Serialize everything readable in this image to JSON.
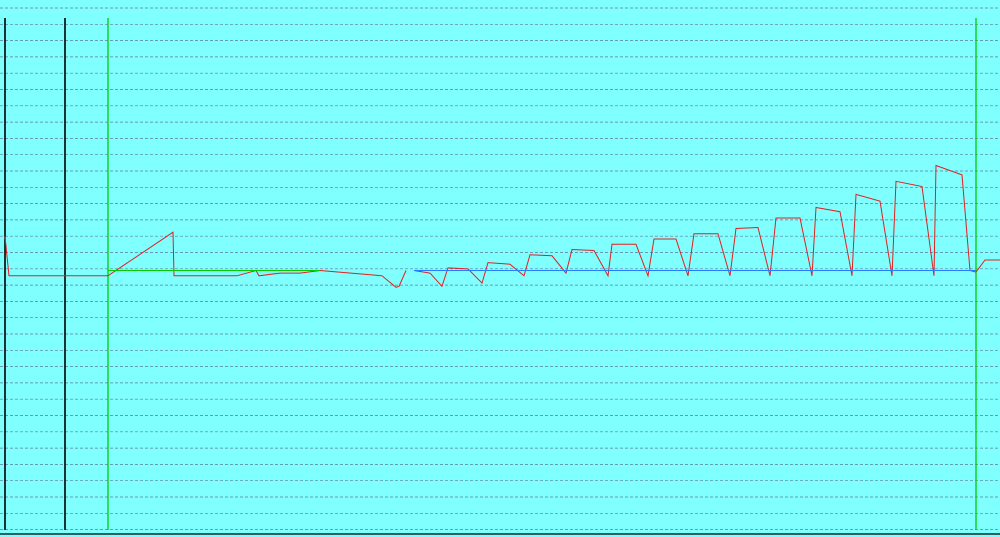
{
  "colors": {
    "background": "#80ffff",
    "grid": "#5a7aa0",
    "axis": "#000000",
    "marker": "#00cc00",
    "series": "#e02020",
    "baseline": "#00cc00",
    "baseline_ext": "#2080ff"
  },
  "chart_data": {
    "type": "line",
    "grid": "horizontal-dashed",
    "xlim": [
      0,
      1000
    ],
    "ylim": [
      0,
      1
    ],
    "axis_markers": [
      {
        "x": 5,
        "kind": "axis"
      },
      {
        "x": 65,
        "kind": "axis"
      },
      {
        "x": 108,
        "kind": "marker"
      },
      {
        "x": 976,
        "kind": "marker"
      }
    ],
    "series": [
      {
        "kind": "main",
        "x": [
          5,
          9,
          108,
          173,
          174,
          237,
          256,
          259,
          280,
          300,
          320,
          382,
          396,
          399,
          406
        ],
        "y": [
          0.565,
          0.49,
          0.49,
          0.573,
          0.49,
          0.49,
          0.5,
          0.49,
          0.495,
          0.495,
          0.5,
          0.49,
          0.468,
          0.47,
          0.5
        ]
      },
      {
        "kind": "main",
        "x": [
          414,
          430,
          442,
          448,
          468,
          482,
          488,
          510,
          524,
          530,
          552,
          566,
          572,
          594,
          608,
          612,
          636,
          648,
          654,
          676,
          688,
          694,
          718,
          730,
          736,
          758,
          770,
          776,
          800,
          812,
          816,
          840,
          852,
          856,
          880,
          892,
          896,
          922,
          934,
          936,
          962,
          970,
          976,
          985,
          1000
        ],
        "y": [
          0.5,
          0.495,
          0.47,
          0.505,
          0.503,
          0.476,
          0.515,
          0.512,
          0.49,
          0.53,
          0.528,
          0.495,
          0.54,
          0.538,
          0.49,
          0.55,
          0.55,
          0.49,
          0.56,
          0.56,
          0.49,
          0.57,
          0.57,
          0.49,
          0.58,
          0.582,
          0.49,
          0.6,
          0.6,
          0.49,
          0.62,
          0.612,
          0.49,
          0.645,
          0.632,
          0.49,
          0.67,
          0.66,
          0.49,
          0.7,
          0.682,
          0.5,
          0.497,
          0.52,
          0.52
        ]
      },
      {
        "kind": "baseline",
        "x": [
          108,
          320
        ],
        "y": [
          0.5,
          0.5
        ]
      },
      {
        "kind": "baseline_ext",
        "x": [
          414,
          976
        ],
        "y": [
          0.5,
          0.5
        ]
      }
    ]
  }
}
